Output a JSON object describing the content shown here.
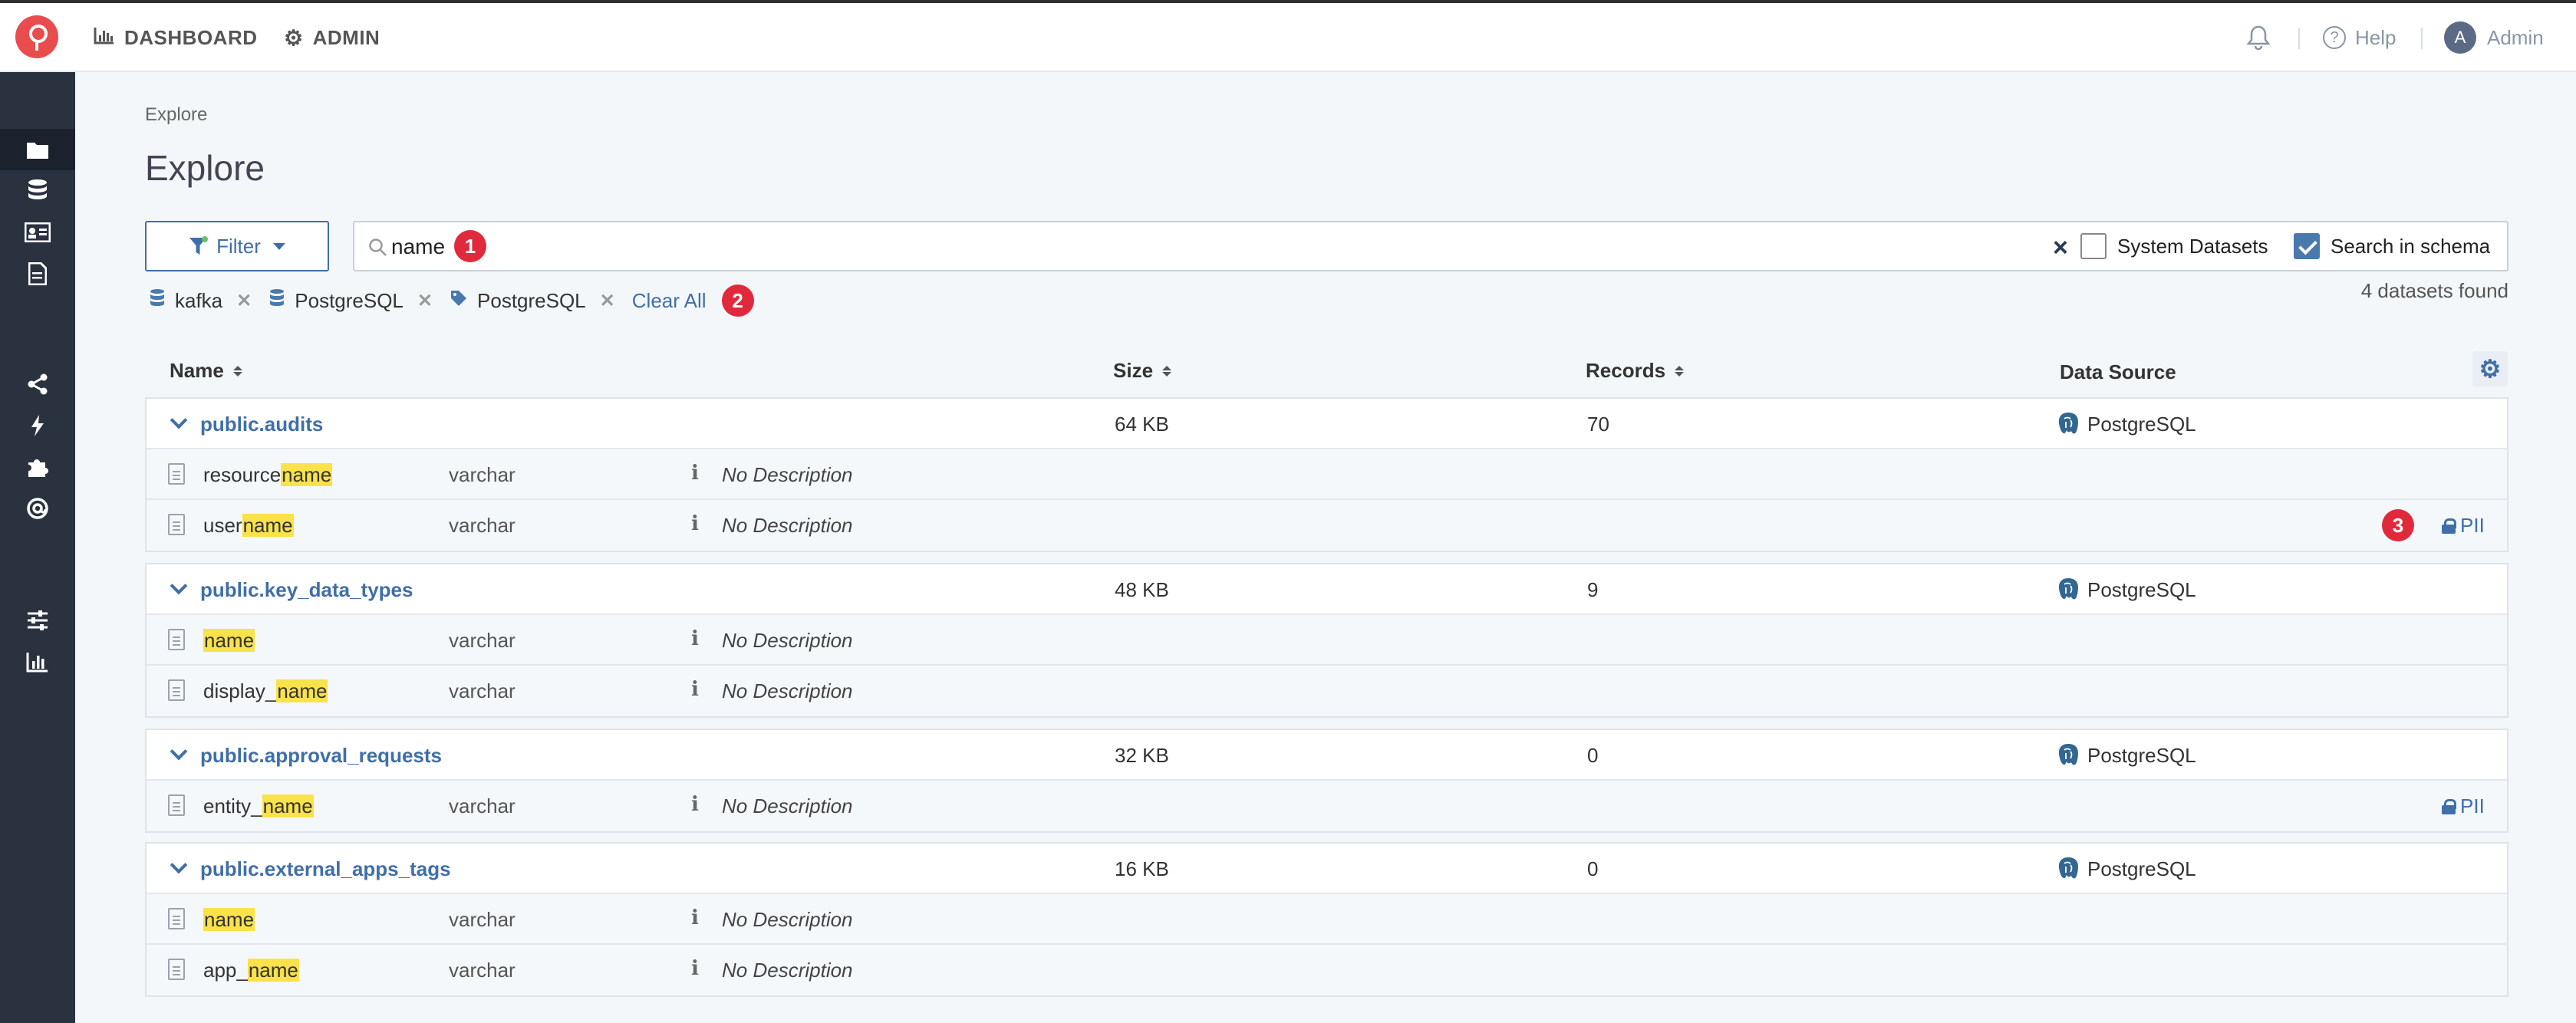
{
  "topnav": {
    "dashboard_label": "DASHBOARD",
    "admin_label": "ADMIN",
    "help_label": "Help",
    "user_initial": "A",
    "user_name": "Admin"
  },
  "breadcrumb": "Explore",
  "page_title": "Explore",
  "filter": {
    "label": "Filter"
  },
  "search": {
    "value": "name",
    "options": {
      "system_datasets": "System Datasets",
      "search_in_schema": "Search in schema"
    },
    "system_datasets_checked": false,
    "search_in_schema_checked": true
  },
  "badges": [
    "1",
    "2",
    "3"
  ],
  "active_filters": [
    {
      "icon": "database-icon",
      "label": "kafka"
    },
    {
      "icon": "database-icon",
      "label": "PostgreSQL"
    },
    {
      "icon": "tag-icon",
      "label": "PostgreSQL"
    }
  ],
  "clear_all_label": "Clear All",
  "results_count": "4 datasets found",
  "table": {
    "headers": {
      "name": "Name",
      "size": "Size",
      "records": "Records",
      "data_source": "Data Source"
    },
    "groups": [
      {
        "name": "public.audits",
        "size": "64 KB",
        "records": "70",
        "source": "PostgreSQL",
        "columns": [
          {
            "prefix": "resource",
            "match": "name",
            "suffix": "",
            "type": "varchar",
            "desc": "No Description",
            "pii": ""
          },
          {
            "prefix": "user",
            "match": "name",
            "suffix": "",
            "type": "varchar",
            "desc": "No Description",
            "pii": "PII"
          }
        ]
      },
      {
        "name": "public.key_data_types",
        "size": "48 KB",
        "records": "9",
        "source": "PostgreSQL",
        "columns": [
          {
            "prefix": "",
            "match": "name",
            "suffix": "",
            "type": "varchar",
            "desc": "No Description",
            "pii": ""
          },
          {
            "prefix": "display_",
            "match": "name",
            "suffix": "",
            "type": "varchar",
            "desc": "No Description",
            "pii": ""
          }
        ]
      },
      {
        "name": "public.approval_requests",
        "size": "32 KB",
        "records": "0",
        "source": "PostgreSQL",
        "columns": [
          {
            "prefix": "entity_",
            "match": "name",
            "suffix": "",
            "type": "varchar",
            "desc": "No Description",
            "pii": "PII"
          }
        ]
      },
      {
        "name": "public.external_apps_tags",
        "size": "16 KB",
        "records": "0",
        "source": "PostgreSQL",
        "columns": [
          {
            "prefix": "",
            "match": "name",
            "suffix": "",
            "type": "varchar",
            "desc": "No Description",
            "pii": ""
          },
          {
            "prefix": "app_",
            "match": "name",
            "suffix": "",
            "type": "varchar",
            "desc": "No Description",
            "pii": ""
          }
        ]
      }
    ]
  },
  "colors": {
    "accent": "#3f6fa8",
    "sidebar": "#2a3240",
    "badge": "#e02a3b",
    "highlight": "#f9e24a"
  }
}
